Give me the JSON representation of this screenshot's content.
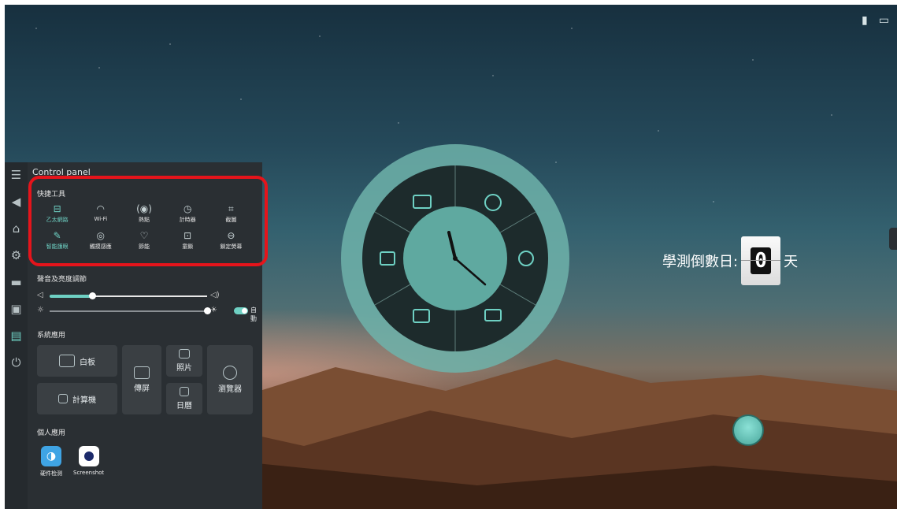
{
  "panel": {
    "title": "Control panel",
    "quick_tools_label": "快捷工具",
    "quick_tools": [
      {
        "label": "乙太網路",
        "icon": "ethernet-icon",
        "active": true
      },
      {
        "label": "Wi-Fi",
        "icon": "wifi-icon",
        "active": false
      },
      {
        "label": "熱點",
        "icon": "hotspot-icon",
        "active": false
      },
      {
        "label": "計時器",
        "icon": "timer-icon",
        "active": false
      },
      {
        "label": "截圖",
        "icon": "crop-icon",
        "active": false
      },
      {
        "label": "智能護眼",
        "icon": "eye-care-icon",
        "active": true
      },
      {
        "label": "觸摸感應",
        "icon": "touch-icon",
        "active": false
      },
      {
        "label": "節能",
        "icon": "energy-save-icon",
        "active": false
      },
      {
        "label": "童鎖",
        "icon": "child-lock-icon",
        "active": false
      },
      {
        "label": "鎖定熒幕",
        "icon": "screen-lock-icon",
        "active": false
      }
    ],
    "sound_brightness_label": "聲音及亮度調節",
    "volume_level": 0.27,
    "brightness_level": 1.0,
    "auto_label": "自動",
    "system_apps_label": "系統應用",
    "system_apps": {
      "whiteboard": "白板",
      "calculator": "計算機",
      "screen_share": "傳屏",
      "photos": "照片",
      "calendar": "日曆",
      "browser": "瀏覽器"
    },
    "personal_apps_label": "個人應用",
    "personal_apps": [
      {
        "label": "硬件检测"
      },
      {
        "label": "Screenshot"
      }
    ]
  },
  "countdown": {
    "label": "學測倒數日:",
    "value": "0",
    "unit": "天"
  },
  "colors": {
    "accent": "#6ed0c3",
    "highlight": "#e5141b",
    "panel_bg": "#2a2f33"
  }
}
